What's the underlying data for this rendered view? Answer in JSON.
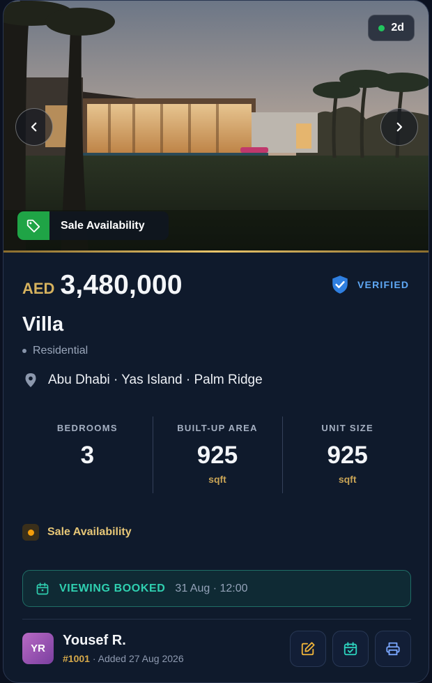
{
  "hero": {
    "age_badge": "2d",
    "availability_label": "Sale Availability"
  },
  "listing": {
    "currency": "AED",
    "price": "3,480,000",
    "verified_label": "VERIFIED",
    "property_type": "Villa",
    "category": "Residential",
    "location": "Abu Dhabi · Yas Island · Palm Ridge"
  },
  "stats": [
    {
      "label": "BEDROOMS",
      "value": "3",
      "unit": ""
    },
    {
      "label": "BUILT-UP AREA",
      "value": "925",
      "unit": "sqft"
    },
    {
      "label": "UNIT SIZE",
      "value": "925",
      "unit": "sqft"
    }
  ],
  "status": {
    "label": "Sale Availability",
    "color": "#f59e0b"
  },
  "viewing": {
    "title": "VIEWING BOOKED",
    "datetime": "31 Aug · 12:00"
  },
  "agent": {
    "initials": "YR",
    "name": "Yousef R.",
    "ref": "#1001",
    "added": " · Added 27 Aug 2026"
  },
  "icons": {
    "age_dot": "green-dot-icon",
    "prev": "chevron-left-icon",
    "next": "chevron-right-icon",
    "tag": "price-tag-icon",
    "verified": "shield-check-icon",
    "location": "map-pin-icon",
    "viewing": "calendar-icon",
    "edit": "edit-icon",
    "schedule": "calendar-check-icon",
    "print": "printer-icon"
  },
  "colors": {
    "gold": "#d6b25e",
    "verified_blue": "#5fa8f5",
    "availability_green": "#1fa446",
    "viewing_teal": "#2fd0b0",
    "edit_amber": "#f0b43a",
    "schedule_teal": "#2dd4bf",
    "print_blue": "#7aa7ff"
  }
}
